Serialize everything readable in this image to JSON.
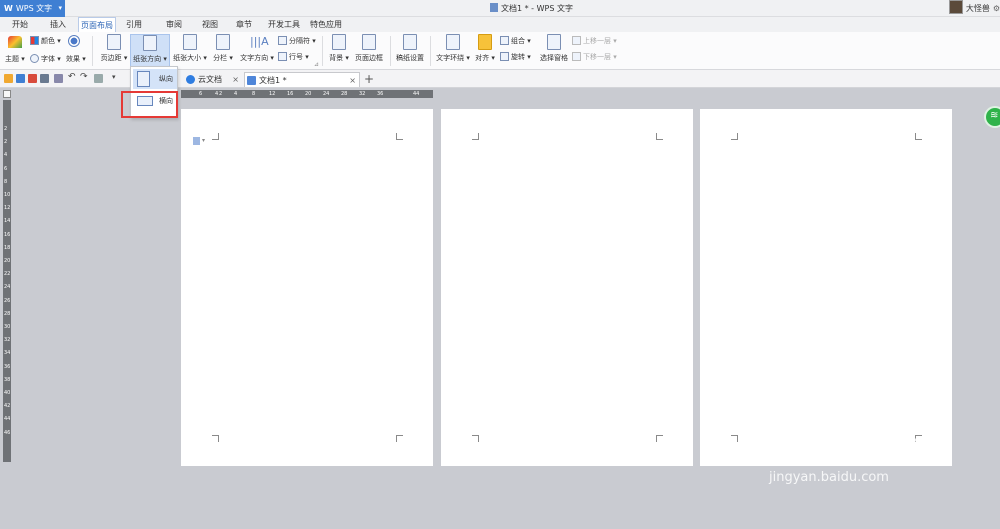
{
  "app": {
    "name": "WPS 文字",
    "logo": "W"
  },
  "window": {
    "title": "文档1 * - WPS 文字",
    "username": "大怪兽"
  },
  "menu_tabs": [
    "开始",
    "插入",
    "页面布局",
    "引用",
    "审阅",
    "视图",
    "章节",
    "开发工具",
    "特色应用"
  ],
  "ribbon": {
    "theme": "主题",
    "color": "颜色",
    "font": "字体",
    "effect": "效果",
    "margins": "页边距",
    "orientation": "纸张方向",
    "paper_size": "纸张大小",
    "columns": "分栏",
    "text_direction": "文字方向",
    "breaks": "分隔符",
    "line_numbers": "行号",
    "background": "背景",
    "page_borders": "页面边框",
    "draft_settings": "稿纸设置",
    "text_wrap": "文字环绕",
    "align": "对齐",
    "rotate": "旋转",
    "group": "组合",
    "selection_pane": "选择窗格",
    "bring_forward": "上移一层",
    "send_backward": "下移一层"
  },
  "doc_tabs": [
    {
      "label": "云文档"
    },
    {
      "label": "文档1 *"
    }
  ],
  "dropdown": {
    "portrait": "纵向",
    "landscape": "横向"
  },
  "ruler_h": [
    "6",
    "4",
    "2",
    "4",
    "8",
    "12",
    "16",
    "20",
    "24",
    "28",
    "32",
    "36",
    "44"
  ],
  "ruler_v": [
    "2",
    "2",
    "4",
    "6",
    "8",
    "10",
    "12",
    "14",
    "16",
    "18",
    "20",
    "22",
    "24",
    "26",
    "28",
    "30",
    "32",
    "34",
    "36",
    "38",
    "40",
    "42",
    "44",
    "46"
  ],
  "watermark": {
    "brand": "Baidu 经验",
    "url": "jingyan.baidu.com"
  }
}
